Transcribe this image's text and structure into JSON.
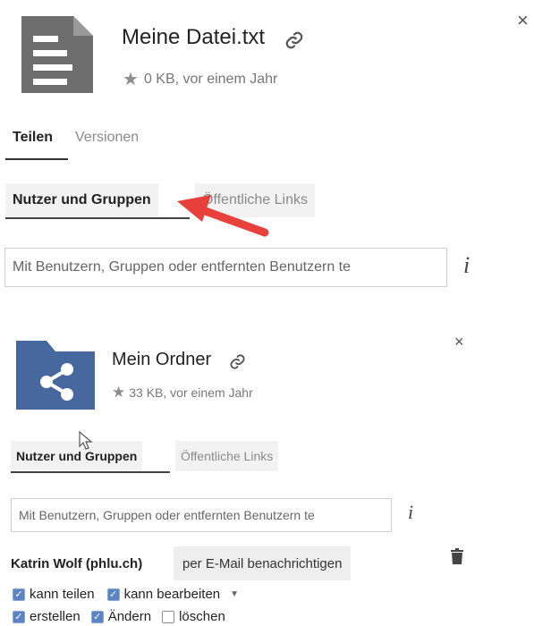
{
  "panel1": {
    "file_name": "Meine Datei.txt",
    "meta": "0 KB, vor einem Jahr",
    "tabs": [
      "Teilen",
      "Versionen"
    ],
    "subtabs": [
      "Nutzer und Gruppen",
      "Öffentliche Links"
    ],
    "search_placeholder": "Mit Benutzern, Gruppen oder entfernten Benutzern te",
    "info_glyph": "i",
    "close_glyph": "×"
  },
  "panel2": {
    "folder_name": "Mein Ordner",
    "meta": "33 KB, vor einem Jahr",
    "subtabs": [
      "Nutzer und Gruppen",
      "Öffentliche Links"
    ],
    "search_placeholder": "Mit Benutzern, Gruppen oder entfernten Benutzern te",
    "info_glyph": "i",
    "close_glyph": "×",
    "share": {
      "user": "Katrin Wolf (phlu.ch)",
      "notify_button": "per E-Mail benachrichtigen",
      "perms_row1": [
        {
          "label": "kann teilen",
          "checked": true
        },
        {
          "label": "kann bearbeiten",
          "checked": true
        }
      ],
      "perms_row2": [
        {
          "label": "erstellen",
          "checked": true
        },
        {
          "label": "Ändern",
          "checked": true
        },
        {
          "label": "löschen",
          "checked": false
        }
      ]
    }
  },
  "colors": {
    "arrow": "#e8403a",
    "folder_blue": "#46689e",
    "file_gray": "#6e6e6e",
    "checkbox_blue": "#5b84c4"
  }
}
